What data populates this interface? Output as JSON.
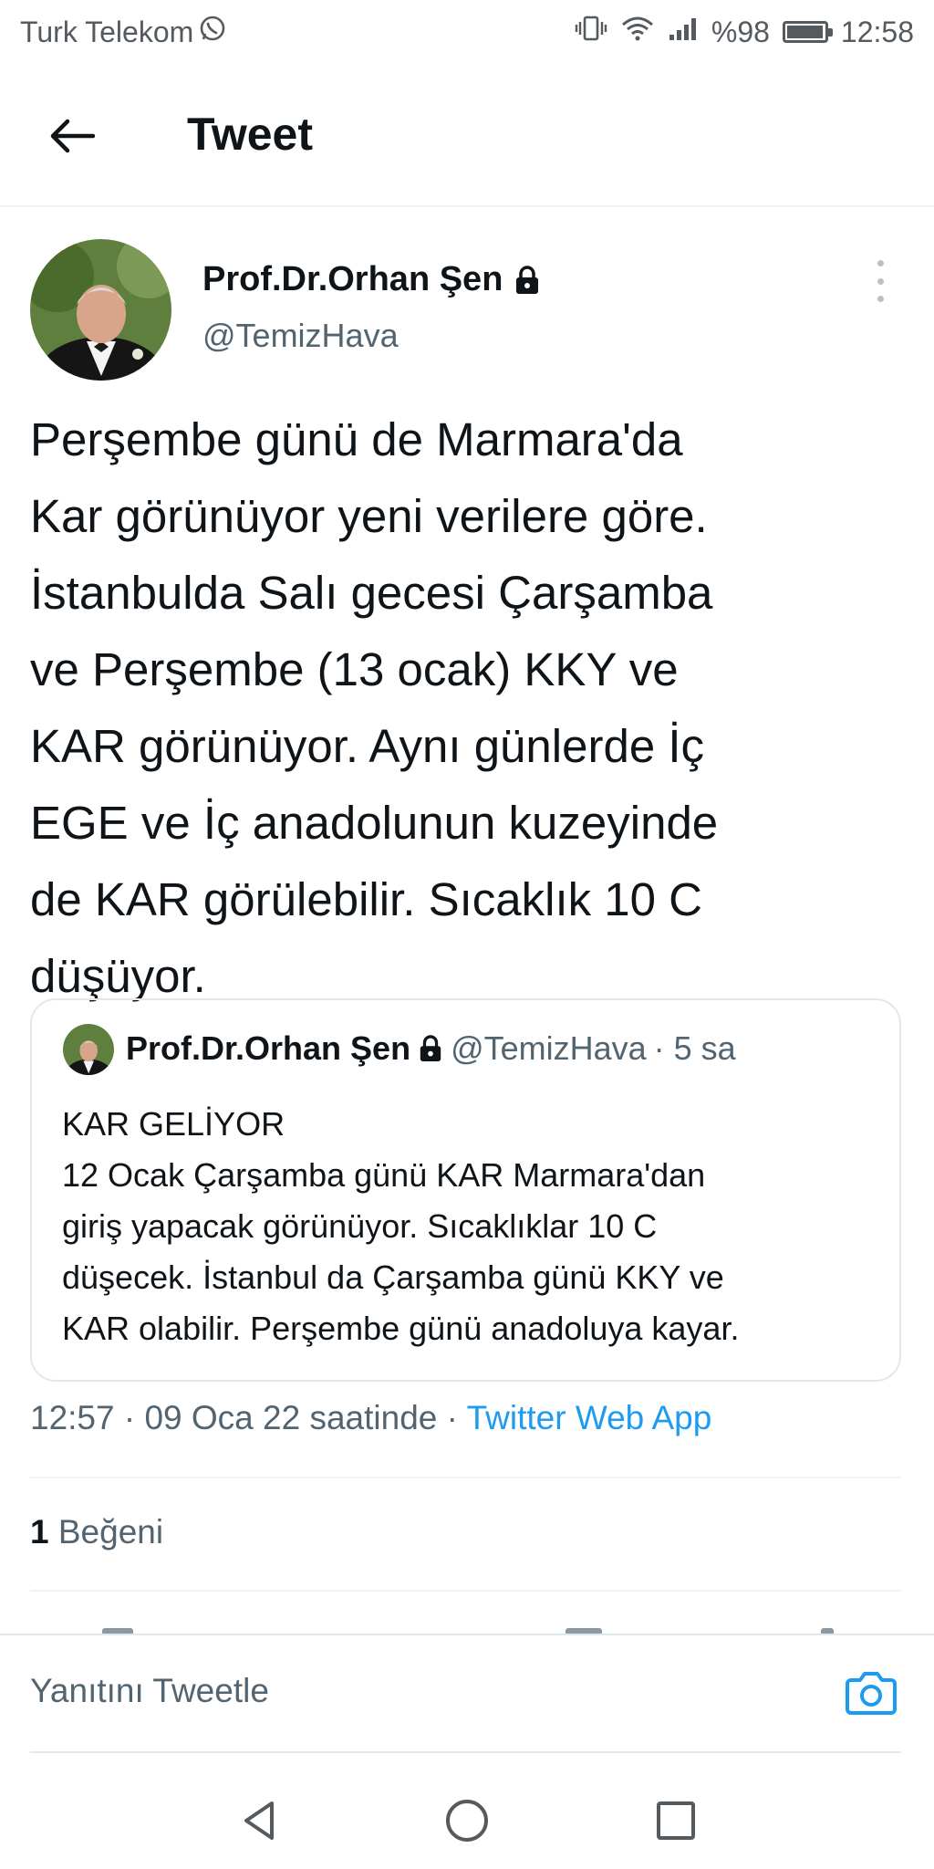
{
  "status_bar": {
    "carrier": "Turk Telekom",
    "whatsapp_icon": "whatsapp-icon",
    "battery_percent_text": "%98",
    "battery_level": 0.98,
    "time": "12:58"
  },
  "header": {
    "title": "Tweet",
    "back_icon": "back-arrow-icon"
  },
  "tweet": {
    "author_name": "Prof.Dr.Orhan Şen",
    "author_handle": "@TemizHava",
    "protected_icon": "lock-icon",
    "text": "Perşembe günü de Marmara'da\nKar görünüyor yeni verilere göre.\nİstanbulda Salı gecesi Çarşamba\nve Perşembe (13 ocak) KKY ve\nKAR görünüyor. Aynı günlerde İç\nEGE ve İç anadolunun kuzeyinde\nde KAR görülebilir. Sıcaklık 10 C\ndüşüyor.",
    "timestamp": "12:57 · 09 Oca 22 saatinde · ",
    "source": "Twitter Web App",
    "likes_count": "1",
    "likes_label": "Beğeni"
  },
  "quoted_tweet": {
    "author_name": "Prof.Dr.Orhan Şen",
    "author_handle": "@TemizHava",
    "age": "· 5 sa",
    "text": "KAR GELİYOR\n12 Ocak Çarşamba günü KAR Marmara'dan\ngiriş yapacak görünüyor. Sıcaklıklar 10 C\ndüşecek. İstanbul da Çarşamba günü KKY ve\nKAR olabilir. Perşembe günü anadoluya kayar."
  },
  "reply_bar": {
    "placeholder": "Yanıtını Tweetle",
    "camera_icon": "camera-icon"
  },
  "nav_bar": {
    "back": "nav-back-icon",
    "home": "nav-home-icon",
    "recents": "nav-recents-icon"
  },
  "colors": {
    "accent": "#1d9bf0",
    "secondary_text": "#536471",
    "primary_text": "#0f1419"
  }
}
